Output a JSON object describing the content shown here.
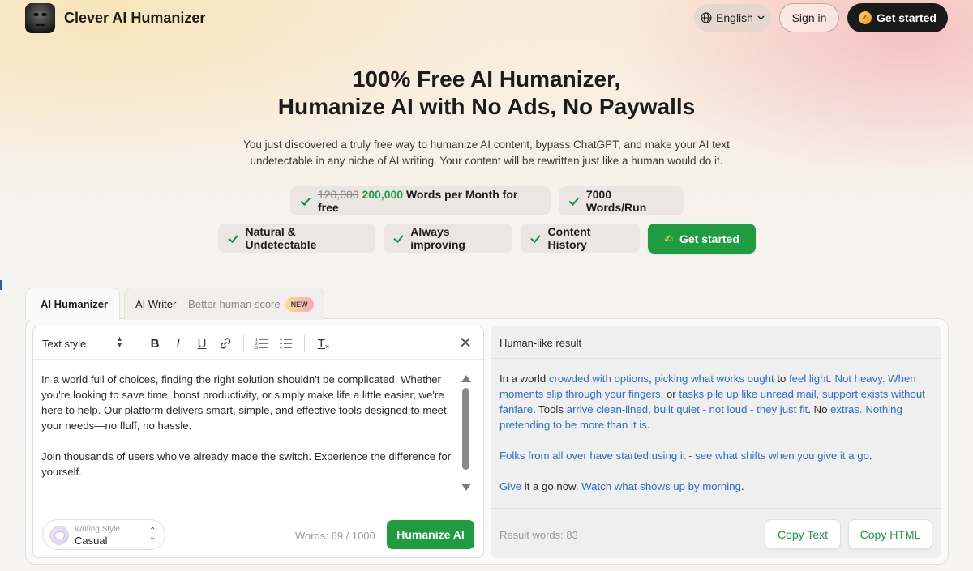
{
  "header": {
    "brand": "Clever AI Humanizer",
    "language": "English",
    "signin_label": "Sign in",
    "get_started_label": "Get started"
  },
  "hero": {
    "title_line1": "100% Free AI Humanizer,",
    "title_line2": "Humanize AI with No Ads, No Paywalls",
    "subtitle_line1": "You just discovered a truly free way to humanize AI content, bypass ChatGPT, and make your AI text",
    "subtitle_line2": "undetectable in any niche of AI writing. Your content will be rewritten just like a human would do it."
  },
  "features": {
    "words_old": "120,000",
    "words_new": "200,000",
    "words_suffix": "Words per Month for free",
    "words_per_run": "7000 Words/Run",
    "natural": "Natural & Undetectable",
    "improving": "Always improving",
    "history": "Content History",
    "cta": "Get started"
  },
  "tabs": {
    "humanizer": "AI Humanizer",
    "writer": "AI Writer",
    "writer_sub": "– Better human score",
    "new_badge": "NEW"
  },
  "editor": {
    "text_style": "Text style",
    "bold": "B",
    "italic": "I",
    "underline": "U",
    "clear_format": "T",
    "input_p1": "In a world full of choices, finding the right solution shouldn't be complicated. Whether you're looking to save time, boost productivity, or simply make life a little easier, we're here to help. Our platform delivers smart, simple, and effective tools designed to meet your needs—no fluff, no hassle.",
    "input_p2": "Join thousands of users who've already made the switch. Experience the difference for yourself.",
    "writing_style_label": "Writing Style",
    "writing_style_value": "Casual",
    "word_count": "Words: 69 / 1000",
    "humanize_label": "Humanize AI"
  },
  "result": {
    "title": "Human-like result",
    "p1": [
      {
        "t": "In a world ",
        "h": false
      },
      {
        "t": "crowded with options",
        "h": true
      },
      {
        "t": ", ",
        "h": false
      },
      {
        "t": "picking what works ought",
        "h": true
      },
      {
        "t": " to ",
        "h": false
      },
      {
        "t": "feel light",
        "h": true
      },
      {
        "t": ". ",
        "h": false
      },
      {
        "t": "Not heavy. When moments slip through your fingers",
        "h": true
      },
      {
        "t": ", or ",
        "h": false
      },
      {
        "t": "tasks pile up like unread mail, support exists without fanfare",
        "h": true
      },
      {
        "t": ". Tools ",
        "h": false
      },
      {
        "t": "arrive clean-lined",
        "h": true
      },
      {
        "t": ", ",
        "h": false
      },
      {
        "t": "built quiet - not loud - they just fit",
        "h": true
      },
      {
        "t": ". No ",
        "h": false
      },
      {
        "t": "extras. Nothing pretending to be more than it is",
        "h": true
      },
      {
        "t": ".",
        "h": false
      }
    ],
    "p2": [
      {
        "t": "Folks from all over have started using it - see what shifts when you give it a go",
        "h": true
      },
      {
        "t": ".",
        "h": false
      }
    ],
    "p3": [
      {
        "t": "Give",
        "h": true
      },
      {
        "t": " it a go now. ",
        "h": false
      },
      {
        "t": "Watch what shows up by morning",
        "h": true
      },
      {
        "t": ".",
        "h": false
      }
    ],
    "word_count": "Result words: 83",
    "copy_text_label": "Copy Text",
    "copy_html_label": "Copy HTML"
  },
  "colors": {
    "accent_green": "#1f9b40",
    "highlight_blue": "#2a6fce"
  }
}
